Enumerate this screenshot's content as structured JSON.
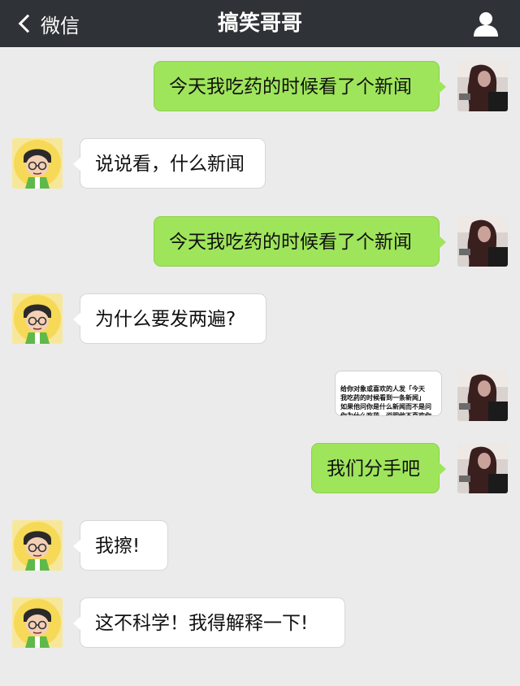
{
  "navbar": {
    "back_label": "微信",
    "title": "搞笑哥哥",
    "profile_icon": "person-icon"
  },
  "messages": [
    {
      "sender": "me",
      "text": "今天我吃药的时候看了个新闻"
    },
    {
      "sender": "other",
      "text": "说说看，什么新闻"
    },
    {
      "sender": "me",
      "text": "今天我吃药的时候看了个新闻"
    },
    {
      "sender": "other",
      "text": "为什么要发两遍?"
    },
    {
      "sender": "me",
      "type": "image",
      "text": "给你对象或喜欢的人发「今天\n我吃药的时候看到一条新闻」\n如果他问你是什么新闻而不是问\n你为什么吃药，说明他不喜欢你"
    },
    {
      "sender": "me",
      "text": "我们分手吧"
    },
    {
      "sender": "other",
      "text": "我擦!"
    },
    {
      "sender": "other",
      "text": "这不科学！我得解释一下!"
    }
  ],
  "colors": {
    "navbar_bg": "#2f3236",
    "outgoing_bubble": "#9fe55b",
    "incoming_bubble": "#ffffff",
    "chat_bg": "#ebebeb"
  }
}
